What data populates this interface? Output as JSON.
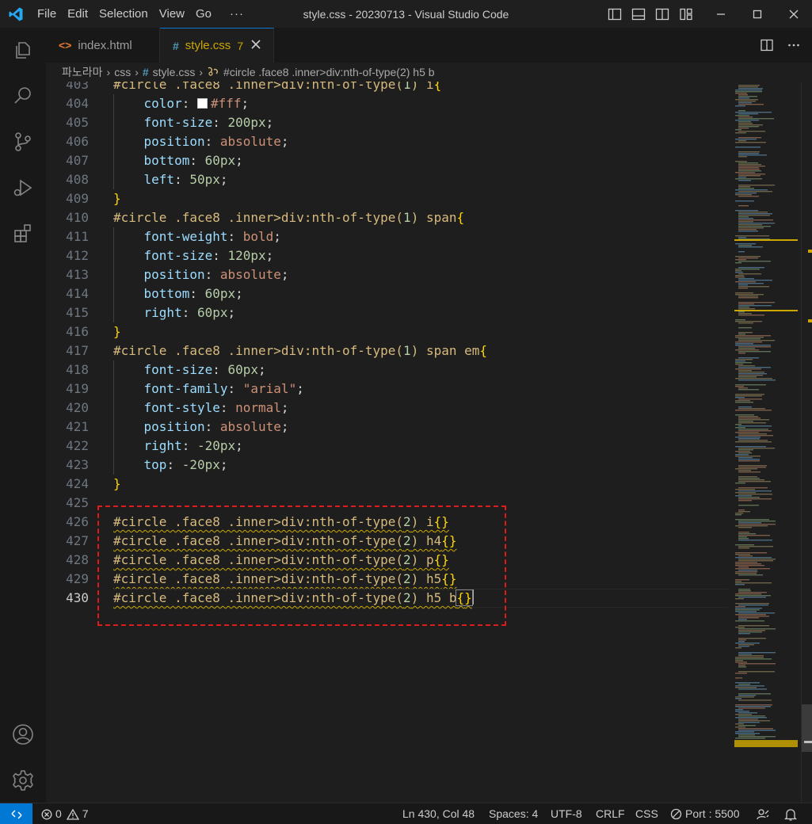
{
  "window": {
    "title": "style.css - 20230713 - Visual Studio Code",
    "menu": [
      "File",
      "Edit",
      "Selection",
      "View",
      "Go"
    ],
    "menu_more": "···"
  },
  "activity_bar": [
    "explorer-icon",
    "search-icon",
    "source-control-icon",
    "run-debug-icon",
    "extensions-icon",
    "accounts-icon",
    "settings-gear-icon"
  ],
  "tabs": [
    {
      "label": "index.html",
      "icon": "html-file-icon",
      "active": false
    },
    {
      "label": "style.css",
      "icon": "css-file-icon",
      "active": true,
      "problems": "7"
    }
  ],
  "breadcrumb": {
    "folder": "파노라마",
    "subfolder": "css",
    "file": "style.css",
    "symbol": "#circle .face8 .inner>div:nth-of-type(2) h5 b"
  },
  "editor": {
    "lines": [
      {
        "n": "403",
        "code": "#circle .face8 .inner>div:nth-of-type(1) i{"
      },
      {
        "n": "404",
        "code": "    color: #fff;"
      },
      {
        "n": "405",
        "code": "    font-size: 200px;"
      },
      {
        "n": "406",
        "code": "    position: absolute;"
      },
      {
        "n": "407",
        "code": "    bottom: 60px;"
      },
      {
        "n": "408",
        "code": "    left: 50px;"
      },
      {
        "n": "409",
        "code": "}"
      },
      {
        "n": "410",
        "code": "#circle .face8 .inner>div:nth-of-type(1) span{"
      },
      {
        "n": "411",
        "code": "    font-weight: bold;"
      },
      {
        "n": "412",
        "code": "    font-size: 120px;"
      },
      {
        "n": "413",
        "code": "    position: absolute;"
      },
      {
        "n": "414",
        "code": "    bottom: 60px;"
      },
      {
        "n": "415",
        "code": "    right: 60px;"
      },
      {
        "n": "416",
        "code": "}"
      },
      {
        "n": "417",
        "code": "#circle .face8 .inner>div:nth-of-type(1) span em{"
      },
      {
        "n": "418",
        "code": "    font-size: 60px;"
      },
      {
        "n": "419",
        "code": "    font-family: \"arial\";"
      },
      {
        "n": "420",
        "code": "    font-style: normal;"
      },
      {
        "n": "421",
        "code": "    position: absolute;"
      },
      {
        "n": "422",
        "code": "    right: -20px;"
      },
      {
        "n": "423",
        "code": "    top: -20px;"
      },
      {
        "n": "424",
        "code": "}"
      },
      {
        "n": "425",
        "code": ""
      },
      {
        "n": "426",
        "code": "#circle .face8 .inner>div:nth-of-type(2) i{}"
      },
      {
        "n": "427",
        "code": "#circle .face8 .inner>div:nth-of-type(2) h4{}"
      },
      {
        "n": "428",
        "code": "#circle .face8 .inner>div:nth-of-type(2) p{}"
      },
      {
        "n": "429",
        "code": "#circle .face8 .inner>div:nth-of-type(2) h5{}"
      },
      {
        "n": "430",
        "code": "#circle .face8 .inner>div:nth-of-type(2) h5 b{}"
      }
    ],
    "current_line": "430"
  },
  "status_bar": {
    "errors": "0",
    "warnings": "7",
    "position": "Ln 430, Col 48",
    "spaces": "Spaces: 4",
    "encoding": "UTF-8",
    "eol": "CRLF",
    "language": "CSS",
    "port": "Port : 5500"
  },
  "colors": {
    "accent": "#0078d4",
    "warning": "#cca700",
    "highlight_box": "#e01b1b"
  }
}
